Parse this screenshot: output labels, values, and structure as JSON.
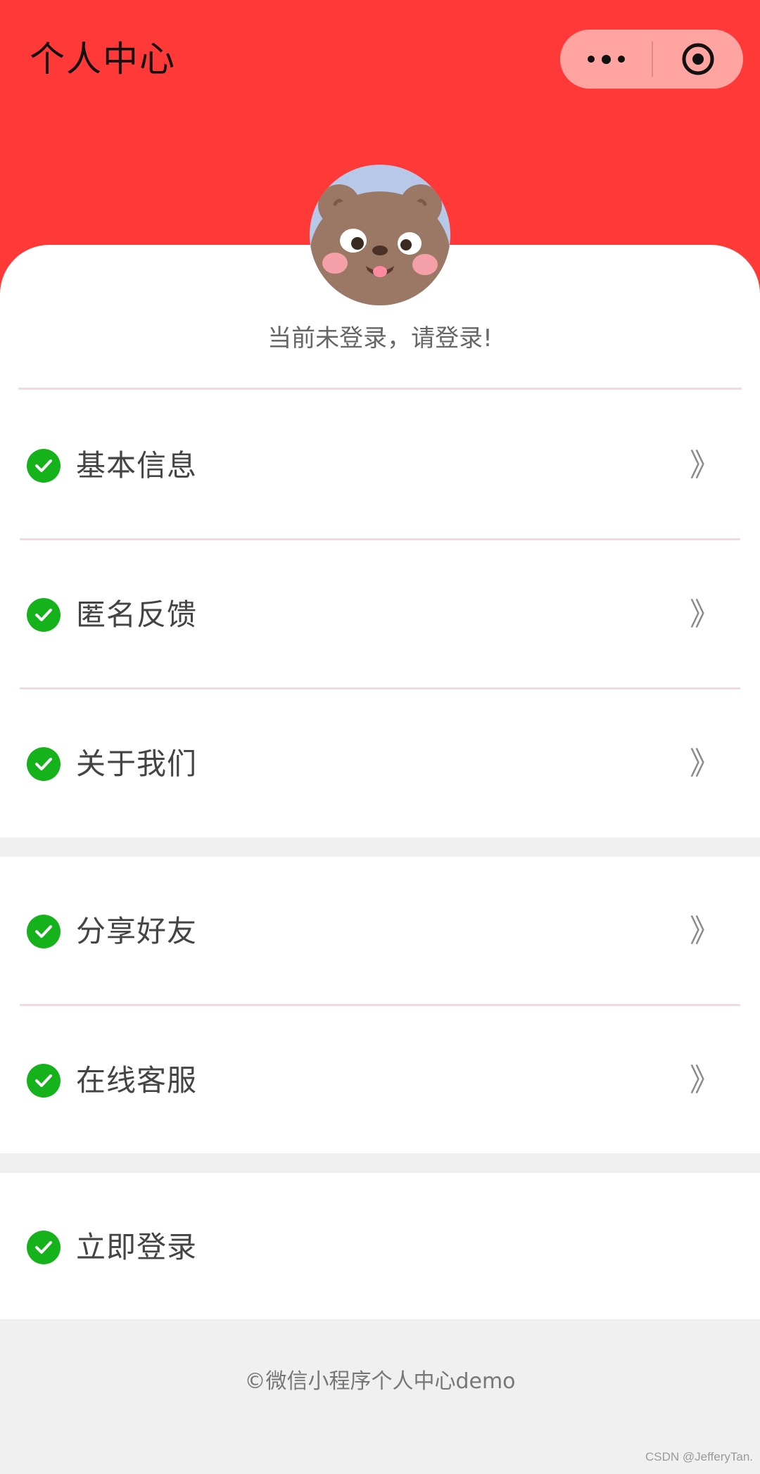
{
  "header": {
    "title": "个人中心",
    "background_color": "#ff3838",
    "capsule": {
      "more_icon": "more-dots-icon",
      "close_icon": "target-circle-icon",
      "background_color": "#ffa4a0"
    }
  },
  "profile": {
    "avatar_icon": "bear-avatar-icon",
    "login_hint": "当前未登录，请登录!"
  },
  "menu": {
    "items": [
      {
        "label": "基本信息",
        "icon": "check-circle-icon",
        "arrow": "》"
      },
      {
        "label": "匿名反馈",
        "icon": "check-circle-icon",
        "arrow": "》"
      },
      {
        "label": "关于我们",
        "icon": "check-circle-icon",
        "arrow": "》"
      },
      {
        "label": "分享好友",
        "icon": "check-circle-icon",
        "arrow": "》"
      },
      {
        "label": "在线客服",
        "icon": "check-circle-icon",
        "arrow": "》"
      },
      {
        "label": "立即登录",
        "icon": "check-circle-icon"
      }
    ],
    "check_color": "#16b21c"
  },
  "footer": {
    "copyright": "©微信小程序个人中心demo"
  },
  "watermark": {
    "text": "CSDN @JefferyTan."
  }
}
